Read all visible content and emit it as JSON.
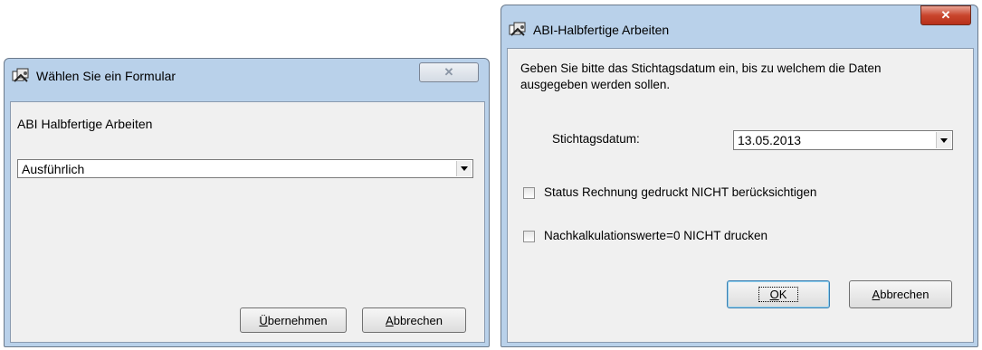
{
  "dialog1": {
    "title": "Wählen Sie ein Formular",
    "heading": "ABI Halbfertige Arbeiten",
    "form_select": {
      "selected": "Ausführlich"
    },
    "apply_button": {
      "mnemonic": "Ü",
      "rest": "bernehmen"
    },
    "cancel_button": {
      "mnemonic": "A",
      "rest": "bbrechen"
    },
    "close_glyph": "✕"
  },
  "dialog2": {
    "title": "ABI-Halbfertige Arbeiten",
    "instruction_line1": "Geben Sie bitte das Stichtagsdatum ein, bis zu welchem die Daten",
    "instruction_line2": "ausgegeben werden sollen.",
    "date_label": "Stichtagsdatum:",
    "date_select": {
      "selected": "13.05.2013"
    },
    "checkbox_status": {
      "label": "Status Rechnung gedruckt NICHT berücksichtigen",
      "checked": false
    },
    "checkbox_nachkalk": {
      "label": "Nachkalkulationswerte=0 NICHT drucken",
      "checked": false
    },
    "ok_button": {
      "mnemonic": "O",
      "rest": "K"
    },
    "cancel_button": {
      "mnemonic": "A",
      "rest": "bbrechen"
    },
    "close_glyph": "✕"
  },
  "icons": [
    "app-icon",
    "close-icon",
    "dropdown-arrow-icon"
  ],
  "colors": {
    "frame": "#b9d1ea",
    "client": "#f0f0f0",
    "close_active": "#c9452d"
  }
}
